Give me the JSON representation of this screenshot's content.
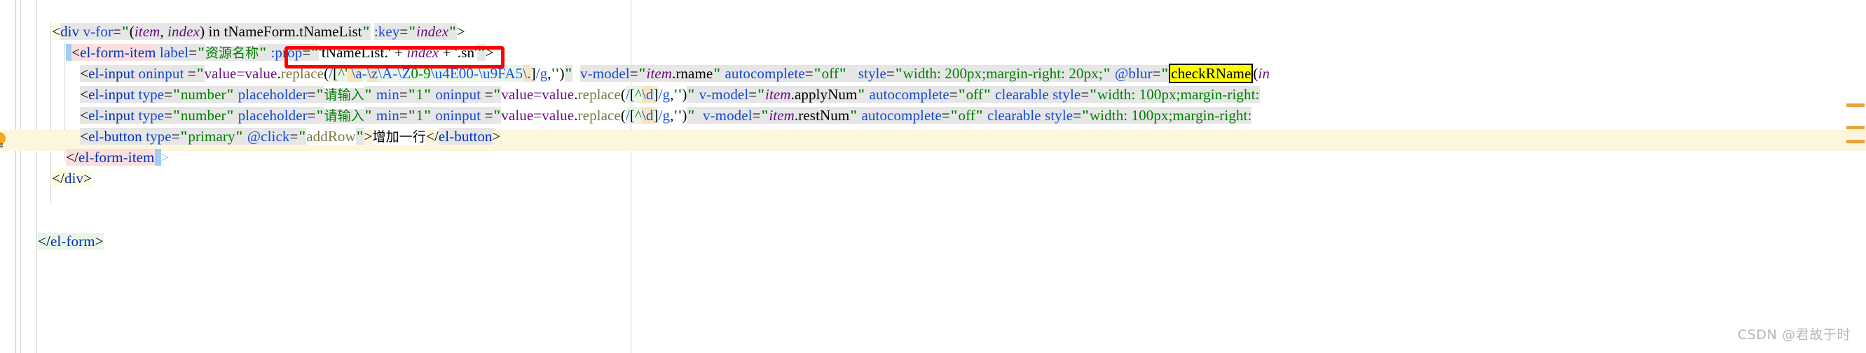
{
  "editor": {
    "language": "vue-html",
    "background_color": "#ffffff",
    "current_line_highlight_color": "#fdf6dd",
    "annotation_box_color": "#fe0000",
    "keyword_highlight_color": "#ffff00"
  },
  "watermark": {
    "text": "CSDN @君故于时"
  },
  "gutter": {
    "bulb_icon": "intention-lightbulb-icon"
  },
  "lines": [
    {
      "id": "line-1",
      "indent": 1,
      "text": "<div v-for=\"(item, index) in tNameForm.tNameList\" :key=\"index\">"
    },
    {
      "id": "line-2",
      "indent": 2,
      "text": "<el-form-item label=\"资源名称\" :prop=\"'tNameList.' + index + '.sn'\">"
    },
    {
      "id": "line-3",
      "indent": 3,
      "text": "<el-input oninput =\"value=value.replace(/[^'\\a-\\z\\A-\\Z0-9\\u4E00-\\u9FA5\\.]/g,'')\"  v-model=\"item.rname\" autocomplete=\"off\"  style=\"width: 200px;margin-right: 20px;\" @blur=\"checkRName(in"
    },
    {
      "id": "line-4",
      "indent": 3,
      "text": "<el-input type=\"number\" placeholder=\"请输入\" min=\"1\" oninput =\"value=value.replace(/[^\\d]/g,'')\" v-model=\"item.applyNum\" autocomplete=\"off\" clearable style=\"width: 100px;margin-right:"
    },
    {
      "id": "line-5",
      "indent": 3,
      "text": "<el-input type=\"number\" placeholder=\"请输入\" min=\"1\" oninput =\"value=value.replace(/[^\\d]/g,'')\"  v-model=\"item.restNum\" autocomplete=\"off\" clearable style=\"width: 100px;margin-right:"
    },
    {
      "id": "line-6",
      "indent": 3,
      "text": "<el-button type=\"primary\" @click=\"addRow\">增加一行</el-button>"
    },
    {
      "id": "line-7",
      "indent": 2,
      "text": "</el-form-item>",
      "current": true
    },
    {
      "id": "line-8",
      "indent": 1,
      "text": "</div>"
    },
    {
      "id": "line-9",
      "indent": 0,
      "text": "</el-form>"
    }
  ],
  "tokens": {
    "line1": {
      "tag": "div",
      "attr_vfor": "v-for",
      "val_vfor": "(item, index) in tNameForm.tNameList",
      "attr_key": ":key",
      "val_key": "index"
    },
    "line2": {
      "tag": "el-form-item",
      "attr_label": "label",
      "val_label": "资源名称",
      "attr_prop": ":prop",
      "val_prop": "'tNameList.' + index + '.sn'"
    },
    "line3": {
      "tag": "el-input",
      "attr_oninput": "oninput",
      "oninput_expr": "value=value.replace(",
      "regex": "/[^'\\a-\\z\\A-\\Z0-9\\u4E00-\\u9FA5\\.]/g",
      "regex_args": ",'')",
      "attr_vmodel": "v-model",
      "val_vmodel": "item.rname",
      "attr_autocomplete": "autocomplete",
      "val_autocomplete": "off",
      "attr_style": "style",
      "val_style": "width: 200px;margin-right: 20px;",
      "attr_blur": "@blur",
      "val_blur_fn": "checkRName",
      "val_blur_arg": "in"
    },
    "line4": {
      "tag": "el-input",
      "attr_type": "type",
      "val_type": "number",
      "attr_placeholder": "placeholder",
      "val_placeholder": "请输入",
      "attr_min": "min",
      "val_min": "1",
      "attr_oninput": "oninput",
      "oninput_expr": "value=value.replace(",
      "regex": "/[^\\d]/g",
      "regex_args": ",'')",
      "attr_vmodel": "v-model",
      "val_vmodel": "item.applyNum",
      "attr_autocomplete": "autocomplete",
      "val_autocomplete": "off",
      "attr_clearable": "clearable",
      "attr_style": "style",
      "val_style": "width: 100px;margin-right:"
    },
    "line5": {
      "tag": "el-input",
      "attr_type": "type",
      "val_type": "number",
      "attr_placeholder": "placeholder",
      "val_placeholder": "请输入",
      "attr_min": "min",
      "val_min": "1",
      "attr_oninput": "oninput",
      "oninput_expr": "value=value.replace(",
      "regex": "/[^\\d]/g",
      "regex_args": ",'')",
      "attr_vmodel": "v-model",
      "val_vmodel": "item.restNum",
      "attr_autocomplete": "autocomplete",
      "val_autocomplete": "off",
      "attr_clearable": "clearable",
      "attr_style": "style",
      "val_style": "width: 100px;margin-right:"
    },
    "line6": {
      "tag": "el-button",
      "attr_type": "type",
      "val_type": "primary",
      "attr_click": "@click",
      "val_click": "addRow",
      "inner_text": "增加一行",
      "close_tag": "el-button"
    },
    "line7": {
      "close_tag": "el-form-item"
    },
    "line8": {
      "close_tag": "div"
    },
    "line9": {
      "close_tag": "el-form"
    }
  }
}
